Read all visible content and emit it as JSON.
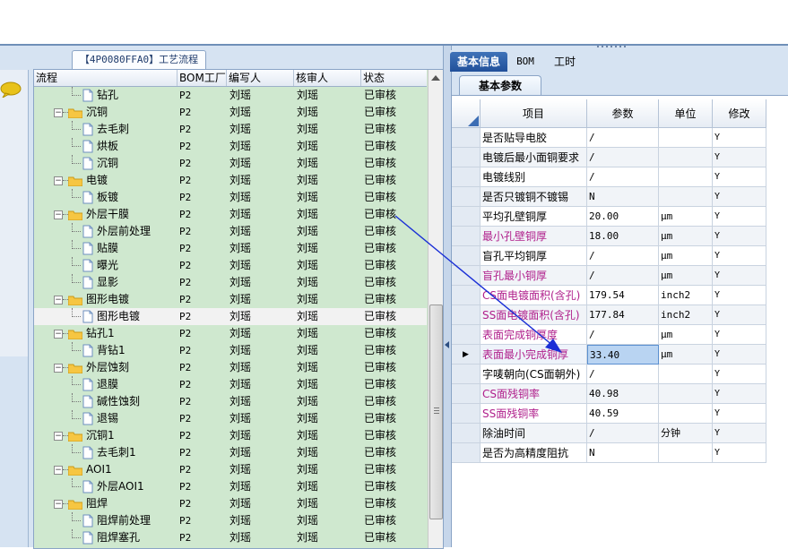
{
  "window": {
    "tab_title": "【4P0080FFA0】工艺流程"
  },
  "tree": {
    "columns": [
      "流程",
      "BOM工厂",
      "编写人",
      "核审人",
      "状态"
    ],
    "rows": [
      {
        "label": "钻孔",
        "type": "leaf",
        "bom": "P2",
        "writer": "刘瑶",
        "reviewer": "刘瑶",
        "status": "已审核"
      },
      {
        "label": "沉铜",
        "type": "group",
        "bom": "P2",
        "writer": "刘瑶",
        "reviewer": "刘瑶",
        "status": "已审核"
      },
      {
        "label": "去毛刺",
        "type": "leaf",
        "bom": "P2",
        "writer": "刘瑶",
        "reviewer": "刘瑶",
        "status": "已审核"
      },
      {
        "label": "烘板",
        "type": "leaf",
        "bom": "P2",
        "writer": "刘瑶",
        "reviewer": "刘瑶",
        "status": "已审核"
      },
      {
        "label": "沉铜",
        "type": "leaf",
        "bom": "P2",
        "writer": "刘瑶",
        "reviewer": "刘瑶",
        "status": "已审核"
      },
      {
        "label": "电镀",
        "type": "group",
        "bom": "P2",
        "writer": "刘瑶",
        "reviewer": "刘瑶",
        "status": "已审核"
      },
      {
        "label": "板镀",
        "type": "leaf",
        "bom": "P2",
        "writer": "刘瑶",
        "reviewer": "刘瑶",
        "status": "已审核"
      },
      {
        "label": "外层干膜",
        "type": "group",
        "bom": "P2",
        "writer": "刘瑶",
        "reviewer": "刘瑶",
        "status": "已审核"
      },
      {
        "label": "外层前处理",
        "type": "leaf",
        "bom": "P2",
        "writer": "刘瑶",
        "reviewer": "刘瑶",
        "status": "已审核"
      },
      {
        "label": "贴膜",
        "type": "leaf",
        "bom": "P2",
        "writer": "刘瑶",
        "reviewer": "刘瑶",
        "status": "已审核"
      },
      {
        "label": "曝光",
        "type": "leaf",
        "bom": "P2",
        "writer": "刘瑶",
        "reviewer": "刘瑶",
        "status": "已审核"
      },
      {
        "label": "显影",
        "type": "leaf",
        "bom": "P2",
        "writer": "刘瑶",
        "reviewer": "刘瑶",
        "status": "已审核"
      },
      {
        "label": "图形电镀",
        "type": "group",
        "bom": "P2",
        "writer": "刘瑶",
        "reviewer": "刘瑶",
        "status": "已审核"
      },
      {
        "label": "图形电镀",
        "type": "leaf",
        "bom": "P2",
        "writer": "刘瑶",
        "reviewer": "刘瑶",
        "status": "已审核",
        "selected": true
      },
      {
        "label": "钻孔1",
        "type": "group",
        "bom": "P2",
        "writer": "刘瑶",
        "reviewer": "刘瑶",
        "status": "已审核"
      },
      {
        "label": "背钻1",
        "type": "leaf",
        "bom": "P2",
        "writer": "刘瑶",
        "reviewer": "刘瑶",
        "status": "已审核"
      },
      {
        "label": "外层蚀刻",
        "type": "group",
        "bom": "P2",
        "writer": "刘瑶",
        "reviewer": "刘瑶",
        "status": "已审核"
      },
      {
        "label": "退膜",
        "type": "leaf",
        "bom": "P2",
        "writer": "刘瑶",
        "reviewer": "刘瑶",
        "status": "已审核"
      },
      {
        "label": "碱性蚀刻",
        "type": "leaf",
        "bom": "P2",
        "writer": "刘瑶",
        "reviewer": "刘瑶",
        "status": "已审核"
      },
      {
        "label": "退锡",
        "type": "leaf",
        "bom": "P2",
        "writer": "刘瑶",
        "reviewer": "刘瑶",
        "status": "已审核"
      },
      {
        "label": "沉铜1",
        "type": "group",
        "bom": "P2",
        "writer": "刘瑶",
        "reviewer": "刘瑶",
        "status": "已审核"
      },
      {
        "label": "去毛刺1",
        "type": "leaf",
        "bom": "P2",
        "writer": "刘瑶",
        "reviewer": "刘瑶",
        "status": "已审核"
      },
      {
        "label": "AOI1",
        "type": "group",
        "bom": "P2",
        "writer": "刘瑶",
        "reviewer": "刘瑶",
        "status": "已审核"
      },
      {
        "label": "外层AOI1",
        "type": "leaf",
        "bom": "P2",
        "writer": "刘瑶",
        "reviewer": "刘瑶",
        "status": "已审核"
      },
      {
        "label": "阻焊",
        "type": "group",
        "bom": "P2",
        "writer": "刘瑶",
        "reviewer": "刘瑶",
        "status": "已审核"
      },
      {
        "label": "阻焊前处理",
        "type": "leaf",
        "bom": "P2",
        "writer": "刘瑶",
        "reviewer": "刘瑶",
        "status": "已审核"
      },
      {
        "label": "阻焊塞孔",
        "type": "leaf",
        "bom": "P2",
        "writer": "刘瑶",
        "reviewer": "刘瑶",
        "status": "已审核"
      }
    ]
  },
  "right": {
    "tabs": [
      "基本信息",
      "BOM",
      "工时"
    ],
    "subtab": "基本参数",
    "grid_columns": [
      "项目",
      "参数",
      "单位",
      "修改"
    ],
    "grid_rows": [
      {
        "item": "是否贴导电胶",
        "param": "/",
        "unit": "",
        "mod": "Y",
        "pink": false
      },
      {
        "item": "电镀后最小面铜要求",
        "param": "/",
        "unit": "",
        "mod": "Y",
        "pink": false
      },
      {
        "item": "电镀线别",
        "param": "/",
        "unit": "",
        "mod": "Y",
        "pink": false
      },
      {
        "item": "是否只镀铜不镀锡",
        "param": "N",
        "unit": "",
        "mod": "Y",
        "pink": false
      },
      {
        "item": "平均孔壁铜厚",
        "param": "20.00",
        "unit": "μm",
        "mod": "Y",
        "pink": false
      },
      {
        "item": "最小孔壁铜厚",
        "param": "18.00",
        "unit": "μm",
        "mod": "Y",
        "pink": true
      },
      {
        "item": "盲孔平均铜厚",
        "param": "/",
        "unit": "μm",
        "mod": "Y",
        "pink": false
      },
      {
        "item": "盲孔最小铜厚",
        "param": "/",
        "unit": "μm",
        "mod": "Y",
        "pink": true
      },
      {
        "item": "CS面电镀面积(含孔)",
        "param": "179.54",
        "unit": "inch2",
        "mod": "Y",
        "pink": true
      },
      {
        "item": "SS面电镀面积(含孔)",
        "param": "177.84",
        "unit": "inch2",
        "mod": "Y",
        "pink": true
      },
      {
        "item": "表面完成铜厚度",
        "param": "/",
        "unit": "μm",
        "mod": "Y",
        "pink": true
      },
      {
        "item": "表面最小完成铜厚",
        "param": "33.40",
        "unit": "μm",
        "mod": "Y",
        "pink": true,
        "current": true
      },
      {
        "item": "字唛朝向(CS面朝外)",
        "param": "/",
        "unit": "",
        "mod": "Y",
        "pink": false
      },
      {
        "item": "CS面残铜率",
        "param": "40.98",
        "unit": "",
        "mod": "Y",
        "pink": true
      },
      {
        "item": "SS面残铜率",
        "param": "40.59",
        "unit": "",
        "mod": "Y",
        "pink": true
      },
      {
        "item": "除油时间",
        "param": "/",
        "unit": "分钟",
        "mod": "Y",
        "pink": false
      },
      {
        "item": "是否为高精度阻抗",
        "param": "N",
        "unit": "",
        "mod": "Y",
        "pink": false
      }
    ]
  },
  "colors": {
    "tree_bg": "#cfe8cf",
    "tab_active": "#2a5aa0",
    "pink_text": "#b0208c",
    "annotation_arrow": "#1a2fd6"
  }
}
